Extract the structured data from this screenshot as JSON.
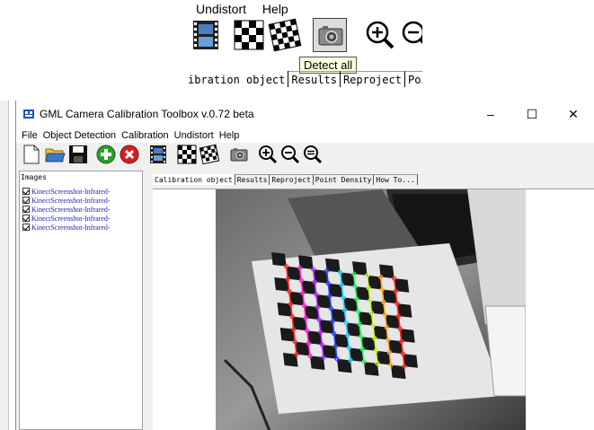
{
  "inset": {
    "menu": [
      "Undistort",
      "Help"
    ],
    "tooltip": "Detect all",
    "tabs": [
      "ibration object",
      "Results",
      "Reproject",
      "Poi"
    ]
  },
  "window": {
    "title": "GML Camera Calibration Toolbox  v.0.72 beta",
    "controls": {
      "minimize": "–",
      "maximize": "☐",
      "close": "✕"
    },
    "menu": [
      "File",
      "Object Detection",
      "Calibration",
      "Undistort",
      "Help"
    ]
  },
  "images_panel": {
    "title": "Images",
    "items": [
      "KinectScreenshot-Infrared-",
      "KinectScreenshot-Infrared-",
      "KinectScreenshot-Infrared-",
      "KinectScreenshot-Infrared-",
      "KinectScreenshot-Infrared-"
    ]
  },
  "tabs": [
    "Calibration object",
    "Results",
    "Reproject",
    "Point Density",
    "How To..."
  ],
  "colors": {
    "accent_green": "#2e9e2e",
    "accent_red": "#d42020",
    "link_blue": "#1f1fb0",
    "tooltip_bg": "#ffffe1"
  }
}
